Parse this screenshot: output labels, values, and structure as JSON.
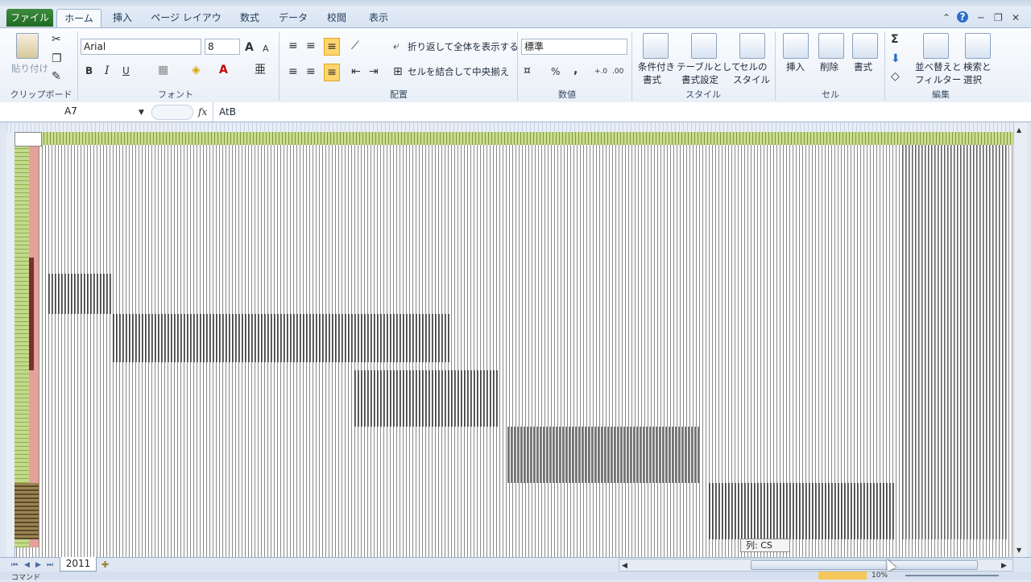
{
  "tabs": {
    "file": "ファイル",
    "home": "ホーム",
    "insert": "挿入",
    "page_layout": "ページ レイアウト",
    "formulas": "数式",
    "data": "データ",
    "review": "校閲",
    "view": "表示"
  },
  "clipboard": {
    "paste": "貼り付け",
    "group": "クリップボード"
  },
  "font": {
    "name": "Arial",
    "size": "8",
    "group": "フォント",
    "bold": "B",
    "italic": "I",
    "underline": "U"
  },
  "alignment": {
    "wrap": "折り返して全体を表示する",
    "merge": "セルを結合して中央揃え",
    "group": "配置"
  },
  "number": {
    "format": "標準",
    "percent": "%",
    "comma": ",",
    "group": "数値"
  },
  "styles": {
    "conditional_1": "条件付き",
    "conditional_2": "書式",
    "table_1": "テーブルとして",
    "table_2": "書式設定",
    "cell_1": "セルの",
    "cell_2": "スタイル",
    "group": "スタイル"
  },
  "cells": {
    "insert": "挿入",
    "delete": "削除",
    "format": "書式",
    "group": "セル"
  },
  "editing": {
    "sort_1": "並べ替えと",
    "sort_2": "フィルター",
    "find_1": "検索と",
    "find_2": "選択",
    "sigma": "Σ",
    "group": "編集"
  },
  "formula_bar": {
    "namebox": "A7",
    "fx": "fx",
    "content": "AtB"
  },
  "sheet": {
    "tab": "2011"
  },
  "tooltip": "列: CS",
  "status": {
    "mode": "コマンド",
    "zoom": "10%"
  }
}
